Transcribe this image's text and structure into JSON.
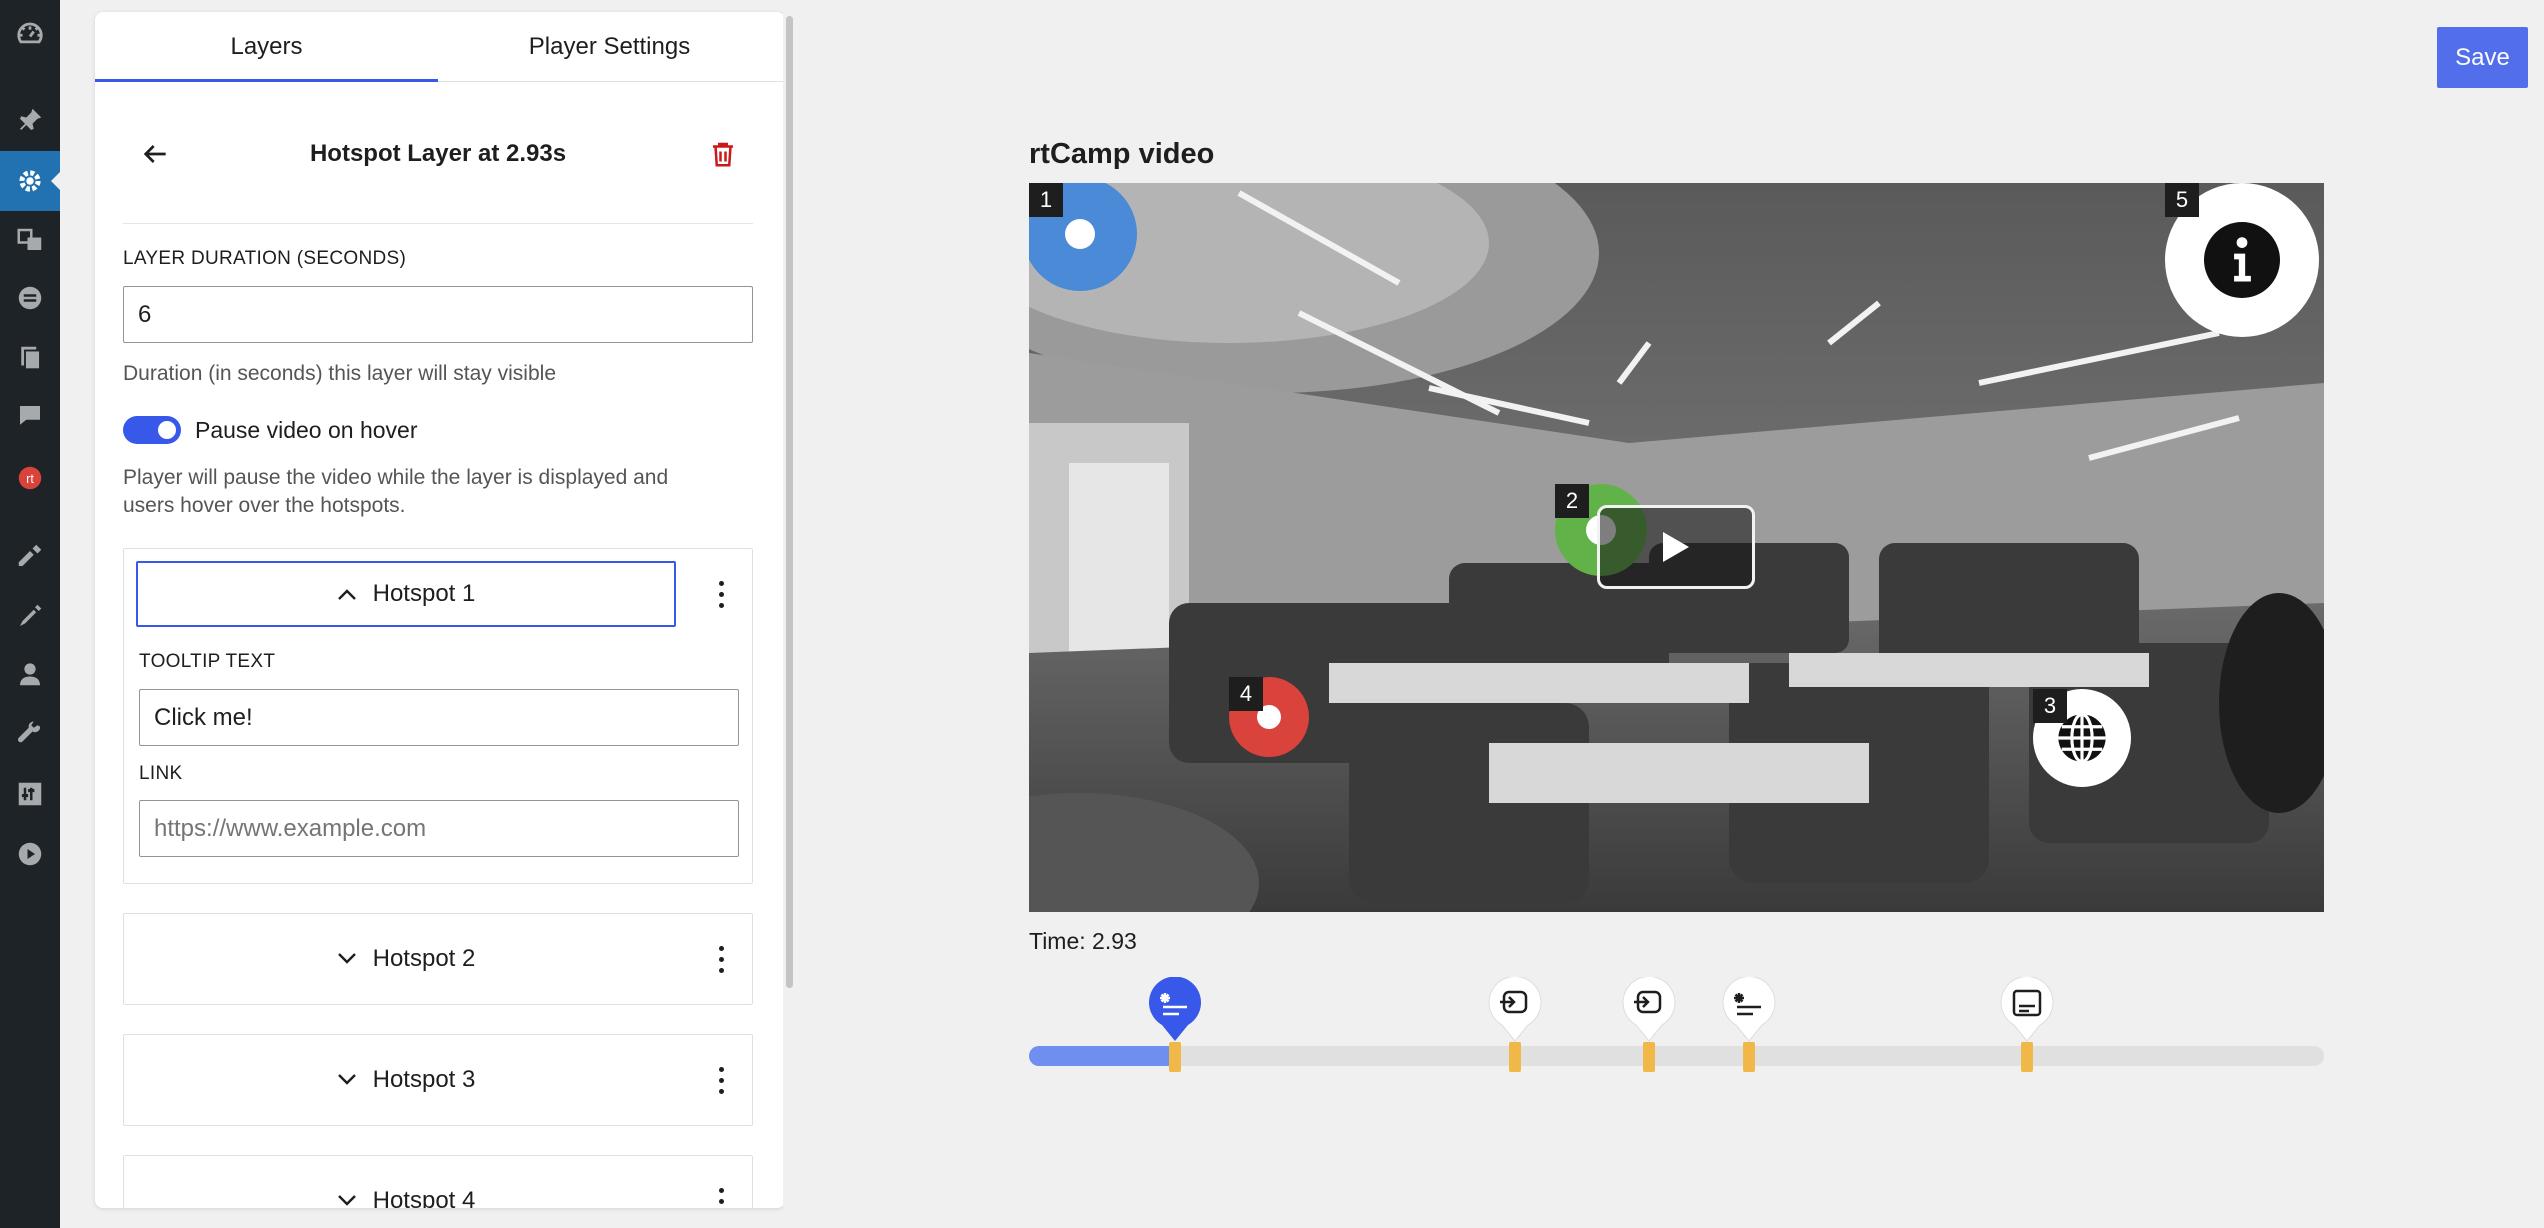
{
  "panel": {
    "tabs": [
      {
        "label": "Layers",
        "active": true
      },
      {
        "label": "Player Settings",
        "active": false
      }
    ],
    "layer_title": "Hotspot Layer at 2.93s",
    "duration_label": "LAYER DURATION (SECONDS)",
    "duration_value": "6",
    "duration_help": "Duration (in seconds) this layer will stay visible",
    "pause_toggle_label": "Pause video on hover",
    "pause_toggle_on": true,
    "pause_help": "Player will pause the video while the layer is displayed and users hover over the hotspots.",
    "hotspots": [
      {
        "label": "Hotspot 1",
        "expanded": true,
        "tooltip_label": "TOOLTIP TEXT",
        "tooltip_value": "Click me!",
        "link_label": "LINK",
        "link_placeholder": "https://www.example.com"
      },
      {
        "label": "Hotspot 2",
        "expanded": false
      },
      {
        "label": "Hotspot 3",
        "expanded": false
      },
      {
        "label": "Hotspot 4",
        "expanded": false
      }
    ]
  },
  "editor": {
    "save_label": "Save",
    "video_title": "rtCamp video",
    "time_label": "Time: 2.93",
    "progress_fraction": 0.108,
    "video_hotspots": [
      {
        "number": "1",
        "color": "#4a8ad6",
        "icon": "dot"
      },
      {
        "number": "2",
        "color": "#62b24a",
        "icon": "dot"
      },
      {
        "number": "3",
        "color": "#ffffff",
        "icon": "globe-icon"
      },
      {
        "number": "4",
        "color": "#d9433b",
        "icon": "dot"
      },
      {
        "number": "5",
        "color": "#ffffff",
        "icon": "info-icon"
      }
    ],
    "timeline_markers": [
      {
        "type": "hotspot-layer",
        "icon": "hotspot-layer-icon",
        "active": true
      },
      {
        "type": "form-layer",
        "icon": "form-layer-icon",
        "active": false
      },
      {
        "type": "form-layer",
        "icon": "form-layer-icon",
        "active": false
      },
      {
        "type": "hotspot-layer",
        "icon": "hotspot-layer-icon",
        "active": false
      },
      {
        "type": "cta-layer",
        "icon": "cta-layer-icon",
        "active": false
      }
    ]
  },
  "colors": {
    "accent": "#3858e9",
    "admin_sidebar": "#1d2327",
    "admin_active": "#2271b1",
    "delete": "#cc1818",
    "tick": "#f0b849",
    "timeline_fill": "#6f8ff0"
  },
  "admin_menu_icons": [
    "dashboard-icon",
    "pin-icon",
    "settings-icon",
    "media-icon",
    "forms-icon",
    "pages-icon",
    "comments-icon",
    "rtcamp-icon",
    "appearance-icon",
    "plugins-icon",
    "users-icon",
    "tools-icon",
    "settings-sliders-icon",
    "video-icon"
  ]
}
